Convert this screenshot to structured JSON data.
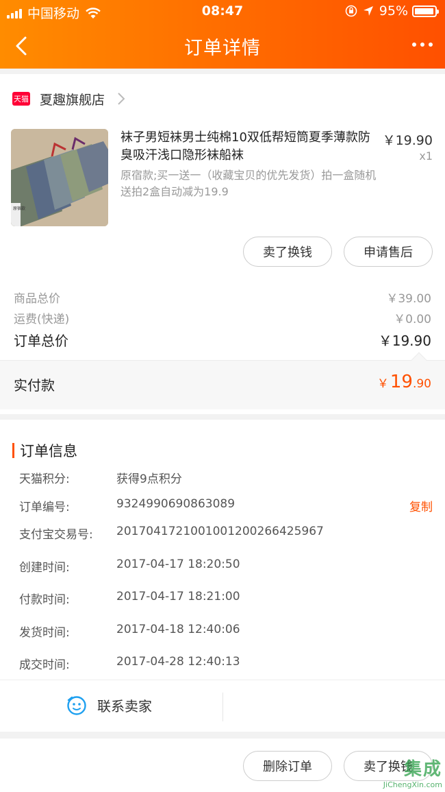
{
  "status_bar": {
    "carrier": "中国移动",
    "time": "08:47",
    "battery_percent": "95%",
    "battery_level": 0.95
  },
  "nav": {
    "title": "订单详情",
    "back_icon": "chevron-left-icon",
    "more_icon": "more-dots-icon"
  },
  "shop": {
    "badge": "天猫",
    "name": "夏趣旗舰店"
  },
  "product": {
    "title": "袜子男短袜男士纯棉10双低帮短筒夏季薄款防臭吸汗浅口隐形袜船袜",
    "sku": "原宿款;买一送一（收藏宝贝的优先发货）拍一盒随机送拍2盒自动减为19.9",
    "price": "￥19.90",
    "quantity": "x1",
    "image_label": "原宿款"
  },
  "item_actions": {
    "sell": "卖了换钱",
    "after_sale": "申请售后"
  },
  "summary": {
    "goods_total_label": "商品总价",
    "goods_total": "￥39.00",
    "shipping_label": "运费(快递)",
    "shipping": "￥0.00",
    "order_total_label": "订单总价",
    "order_total": "￥19.90",
    "paid_label": "实付款",
    "paid_symbol": "￥",
    "paid_integer": "19",
    "paid_decimal": ".90"
  },
  "order_info": {
    "title": "订单信息",
    "rows": [
      {
        "label": "天猫积分:",
        "value": "获得9点积分"
      },
      {
        "label": "订单编号:",
        "value": "9324990690863089",
        "action": "复制"
      },
      {
        "label": "支付宝交易号:",
        "value": "2017041721001001200266425967"
      },
      {
        "label": "创建时间:",
        "value": "2017-04-17 18:20:50"
      },
      {
        "label": "付款时间:",
        "value": "2017-04-17 18:21:00"
      },
      {
        "label": "发货时间:",
        "value": "2017-04-18 12:40:06"
      },
      {
        "label": "成交时间:",
        "value": "2017-04-28 12:40:13"
      }
    ]
  },
  "contact": {
    "label": "联系卖家",
    "icon": "chat-face-icon"
  },
  "bottom_actions": {
    "delete": "删除订单",
    "sell": "卖了换钱"
  },
  "watermark": {
    "mark": "集成",
    "site": "JiChengXin.com"
  },
  "colors": {
    "accent": "#ff5000",
    "header_start": "#ff8c00",
    "header_end": "#ff5000",
    "tmall_red": "#ff0036"
  }
}
